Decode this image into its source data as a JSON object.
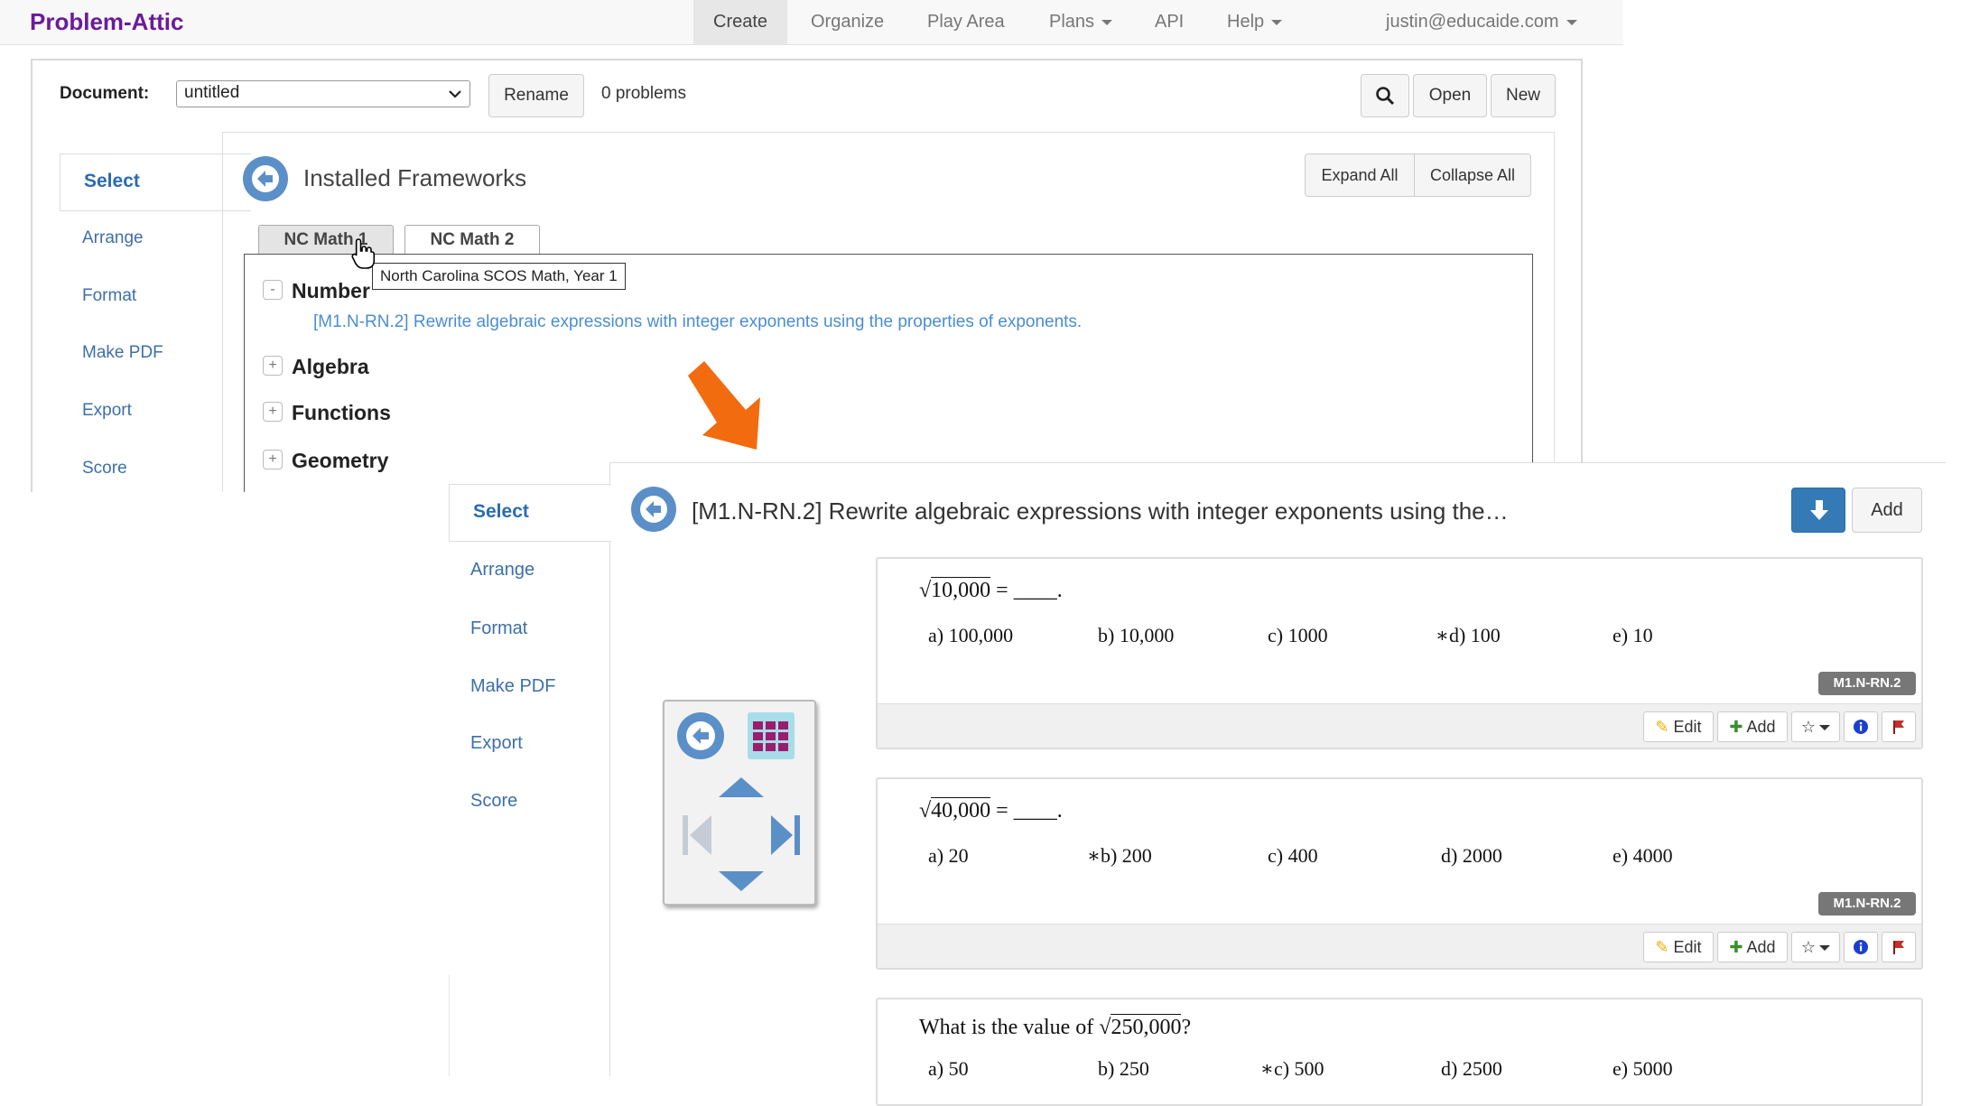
{
  "navbar": {
    "brand": "Problem-Attic",
    "items": [
      "Create",
      "Organize",
      "Play Area",
      "Plans",
      "API",
      "Help"
    ],
    "user": "justin@educaide.com"
  },
  "document": {
    "label": "Document:",
    "selected": "untitled",
    "rename_label": "Rename",
    "count": "0 problems",
    "open_label": "Open",
    "new_label": "New"
  },
  "sidenav": [
    "Select",
    "Arrange",
    "Format",
    "Make PDF",
    "Export",
    "Score"
  ],
  "frameworks": {
    "title": "Installed Frameworks",
    "expand_all": "Expand All",
    "collapse_all": "Collapse All",
    "tabs": [
      "NC Math 1",
      "NC Math 2"
    ],
    "tooltip": "North Carolina SCOS Math, Year 1",
    "tree": [
      {
        "label": "Number",
        "toggle": "-",
        "children": [
          "[M1.N-RN.2] Rewrite algebraic expressions with integer exponents using the properties of exponents."
        ]
      },
      {
        "label": "Algebra",
        "toggle": "+"
      },
      {
        "label": "Functions",
        "toggle": "+"
      },
      {
        "label": "Geometry",
        "toggle": "+"
      }
    ]
  },
  "standard_view": {
    "title": "[M1.N-RN.2] Rewrite algebraic expressions with integer exponents using the…",
    "add_label": "Add",
    "problems": [
      {
        "radicand": "10,000",
        "rest": "= ____.",
        "options": [
          "a)  100,000",
          "b)  10,000",
          "c)  1000",
          "∗d)  100",
          "e)  10"
        ],
        "tag": "M1.N-RN.2"
      },
      {
        "radicand": "40,000",
        "rest": "= ____.",
        "options": [
          "a)  20",
          "∗b)  200",
          "c)  400",
          "d)  2000",
          "e)  4000"
        ],
        "tag": "M1.N-RN.2"
      },
      {
        "prefix": "What is the value of",
        "radicand": "250,000",
        "rest": "?",
        "options": [
          "a)  50",
          "b)  250",
          "∗c)  500",
          "d)  2500",
          "e)  5000"
        ]
      }
    ],
    "actions": {
      "edit": "Edit",
      "add": "Add"
    }
  },
  "colors": {
    "accent": "#337ab7",
    "brand": "#6a1b9a",
    "arrow": "#f26b0f",
    "grid": "#9c1d6e"
  }
}
